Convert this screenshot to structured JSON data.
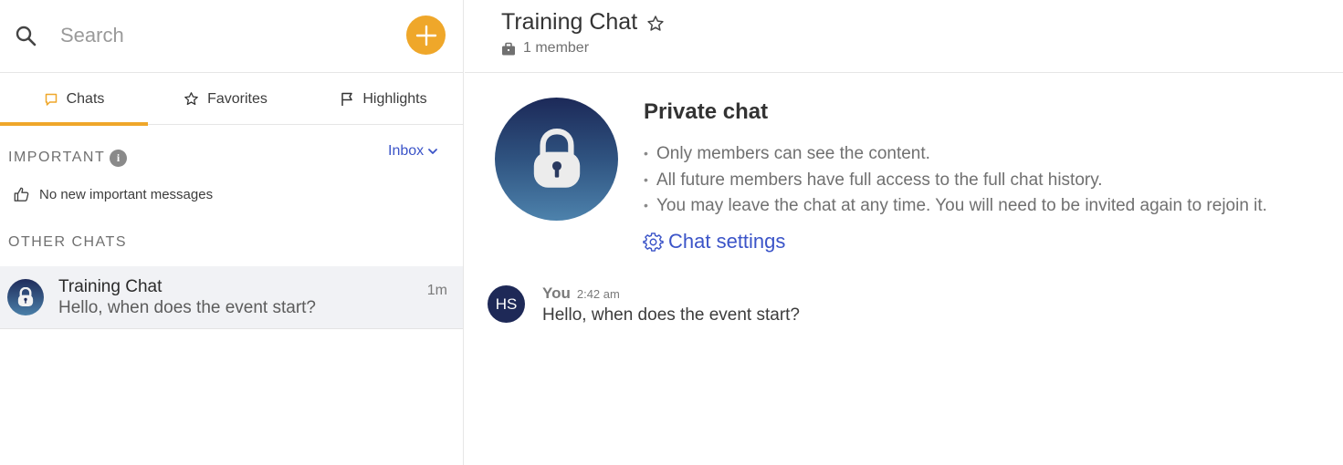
{
  "search": {
    "placeholder": "Search"
  },
  "tabs": [
    {
      "label": "Chats",
      "icon": "chat-bubble-icon",
      "active": true
    },
    {
      "label": "Favorites",
      "icon": "star-icon",
      "active": false
    },
    {
      "label": "Highlights",
      "icon": "flag-icon",
      "active": false
    }
  ],
  "important": {
    "label": "IMPORTANT",
    "info_icon": "i",
    "filter_label": "Inbox",
    "empty_text": "No new important messages"
  },
  "other_chats": {
    "label": "OTHER CHATS",
    "items": [
      {
        "title": "Training Chat",
        "preview": "Hello, when does the event start?",
        "time": "1m"
      }
    ]
  },
  "header": {
    "title": "Training Chat",
    "member_count": "1 member"
  },
  "private_chat": {
    "title": "Private chat",
    "bullets": [
      "Only members can see the content.",
      "All future members have full access to the full chat history.",
      "You may leave the chat at any time. You will need to be invited again to rejoin it."
    ],
    "settings_label": "Chat settings"
  },
  "messages": [
    {
      "initials": "HS",
      "author": "You",
      "time": "2:42 am",
      "text": "Hello, when does the event start?"
    }
  ],
  "colors": {
    "accent": "#efa72a",
    "link": "#3b54c8",
    "avatar_dark": "#1e2957"
  }
}
